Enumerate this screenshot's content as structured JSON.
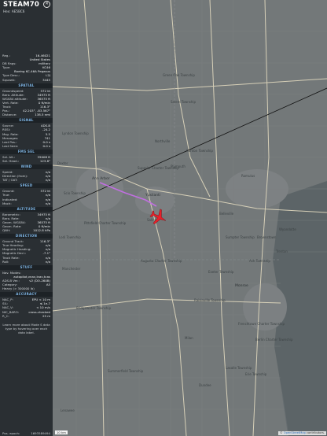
{
  "header": {
    "callsign": "STEAM70",
    "hex_label": "Hex:",
    "hex": "AE5BC6"
  },
  "info": [
    {
      "k": "Reg.:",
      "v": "16-46021"
    },
    {
      "k": "",
      "v": "United States"
    },
    {
      "k": "DB flags:",
      "v": "military"
    },
    {
      "k": "Type:",
      "v": "KC46"
    },
    {
      "k": "",
      "v": "Boeing KC-46A Pegasus"
    },
    {
      "k": "Type Desc.:",
      "v": "L2J"
    },
    {
      "k": "Squawk:",
      "v": "3445"
    }
  ],
  "sections": [
    {
      "title": "SPATIAL",
      "rows": [
        {
          "k": "Groundspeed:",
          "v": "572 kt"
        },
        {
          "k": "Baro. Altitude:",
          "v": "34975 ft"
        },
        {
          "k": "WGS84 altitude:",
          "v": "36575 ft"
        },
        {
          "k": "Vert. Rate:",
          "v": "0 ft/min"
        },
        {
          "k": "Track:",
          "v": "116.3°"
        },
        {
          "k": "Pos.:",
          "v": "42.203°, -83.567°"
        },
        {
          "k": "Distance:",
          "v": "138.5 nmi"
        }
      ]
    },
    {
      "title": "SIGNAL",
      "rows": [
        {
          "k": "Source:",
          "v": "ADS-B"
        },
        {
          "k": "RSSI:",
          "v": "-24.2"
        },
        {
          "k": "Msg. Rate:",
          "v": "5.5"
        },
        {
          "k": "Messages:",
          "v": "741"
        },
        {
          "k": "Last Pos.:",
          "v": "0.0 s"
        },
        {
          "k": "Last Seen:",
          "v": "0.0 s"
        }
      ]
    },
    {
      "title": "FMS SEL",
      "rows": [
        {
          "k": "Sel. Alt.:",
          "v": "35008 ft"
        },
        {
          "k": "Sel. Head.:",
          "v": "123.8°"
        }
      ]
    },
    {
      "title": "WIND",
      "rows": [
        {
          "k": "Speed:",
          "v": "n/a"
        },
        {
          "k": "Direction (from):",
          "v": "n/a"
        },
        {
          "k": "TAT / OAT:",
          "v": "n/a"
        }
      ]
    },
    {
      "title": "SPEED",
      "rows": [
        {
          "k": "Ground:",
          "v": "572 kt"
        },
        {
          "k": "True:",
          "v": "n/a"
        },
        {
          "k": "Indicated:",
          "v": "n/a"
        },
        {
          "k": "Mach:",
          "v": "n/a"
        }
      ]
    },
    {
      "title": "ALTITUDE",
      "rows": [
        {
          "k": "Barometric:",
          "v": "34975 ft"
        },
        {
          "k": "Baro. Rate:",
          "v": "n/a"
        },
        {
          "k": "Geom. WGS84:",
          "v": "36575 ft"
        },
        {
          "k": "Geom. Rate:",
          "v": "0 ft/min"
        },
        {
          "k": "QNH:",
          "v": "1012.8 hPa"
        }
      ]
    },
    {
      "title": "DIRECTION",
      "rows": [
        {
          "k": "Ground Track:",
          "v": "116.3°"
        },
        {
          "k": "True Heading:",
          "v": "n/a"
        },
        {
          "k": "Magnetic Heading:",
          "v": "n/a"
        },
        {
          "k": "Magnetic Decl.:",
          "v": "-7.1°"
        },
        {
          "k": "Track Rate:",
          "v": "n/a"
        },
        {
          "k": "Roll:",
          "v": "n/a"
        }
      ]
    },
    {
      "title": "STUFF",
      "rows": [
        {
          "k": "Nav. Modes:",
          "v": ""
        },
        {
          "k": "",
          "v": "autopilot,vnav,lnav,tcas"
        },
        {
          "k": "ADS-B Ver.:",
          "v": "v2 (DO-260B)"
        },
        {
          "k": "Category:",
          "v": "A5"
        },
        {
          "k": "Heavy (> 300000 lb)",
          "v": ""
        }
      ]
    },
    {
      "title": "ACCURACY",
      "rows": [
        {
          "k": "NAC_P:",
          "v": "EPU < 10 m"
        },
        {
          "k": "SIL:",
          "v": "≤ 1e-7"
        },
        {
          "k": "NAC_V:",
          "v": "< 10 m/s"
        },
        {
          "k": "NIC_BARO:",
          "v": "cross-checked"
        },
        {
          "k": "R_C:",
          "v": "25 m"
        }
      ]
    }
  ],
  "note": "Learn more about Mode S data type by hovering over each data label.",
  "epoch": {
    "k": "Pos. epoch:",
    "v": "1693589494"
  },
  "map": {
    "labels": [
      {
        "t": "Ann Arbor",
        "cls": "city"
      },
      {
        "t": "Ypsilanti",
        "cls": "city"
      },
      {
        "t": "Saline",
        "cls": ""
      },
      {
        "t": "Plymouth",
        "cls": ""
      },
      {
        "t": "Monroe",
        "cls": "city"
      },
      {
        "t": "Augusta Charter Township",
        "cls": ""
      },
      {
        "t": "Milan",
        "cls": ""
      },
      {
        "t": "Dundee",
        "cls": ""
      },
      {
        "t": "Romulus",
        "cls": ""
      },
      {
        "t": "Belleville",
        "cls": ""
      },
      {
        "t": "Canton Township",
        "cls": ""
      },
      {
        "t": "Northville",
        "cls": ""
      },
      {
        "t": "Superior Charter Township",
        "cls": ""
      },
      {
        "t": "Pittsfield Charter Township",
        "cls": ""
      },
      {
        "t": "Sumpter Township",
        "cls": ""
      },
      {
        "t": "Exeter Township",
        "cls": ""
      },
      {
        "t": "Frenchtown Charter Township",
        "cls": ""
      },
      {
        "t": "Raisinville Township",
        "cls": ""
      },
      {
        "t": "Ash Township",
        "cls": ""
      },
      {
        "t": "Erie Township",
        "cls": ""
      },
      {
        "t": "Lasalle Township",
        "cls": ""
      },
      {
        "t": "Summerfield Township",
        "cls": ""
      },
      {
        "t": "Lenawee",
        "cls": ""
      },
      {
        "t": "Berlin Charter Township",
        "cls": ""
      },
      {
        "t": "Green Oak Township",
        "cls": ""
      },
      {
        "t": "Salem Township",
        "cls": ""
      },
      {
        "t": "Dexter",
        "cls": ""
      },
      {
        "t": "Lyndon Township",
        "cls": ""
      },
      {
        "t": "Lodi Township",
        "cls": ""
      },
      {
        "t": "Scio Township",
        "cls": ""
      },
      {
        "t": "Manchester",
        "cls": ""
      },
      {
        "t": "Bridgewater Township",
        "cls": ""
      },
      {
        "t": "Wyandotte",
        "cls": ""
      },
      {
        "t": "Trenton",
        "cls": ""
      },
      {
        "t": "Brownstown",
        "cls": ""
      }
    ],
    "attribution": {
      "prefix": "© ",
      "link": "OpenStreetMap",
      "suffix": " contributors."
    },
    "scale": "10 km",
    "colors": {
      "aircraft": "#e8202a",
      "trail": "#c06fe0",
      "route": "#111111",
      "roads": "#d7d0b8"
    },
    "aircraft_icon": "airplane-icon",
    "aircraft_track_deg": 116.3
  }
}
